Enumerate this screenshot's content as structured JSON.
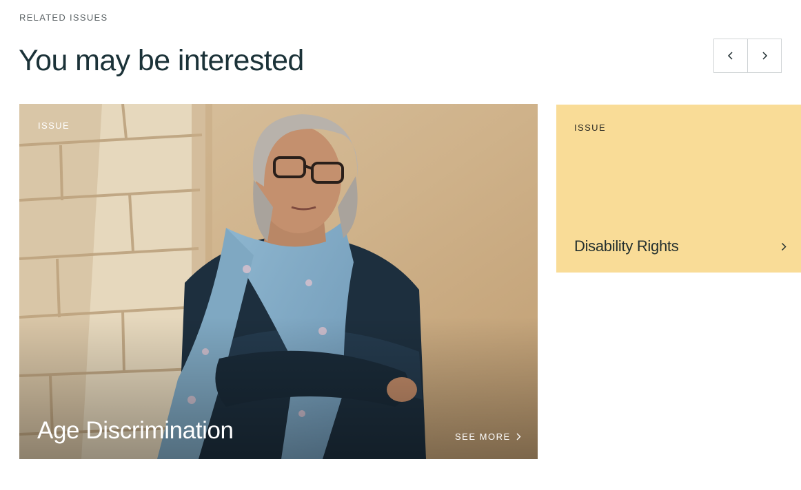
{
  "section": {
    "eyebrow": "RELATED ISSUES",
    "heading": "You may be interested"
  },
  "pager": {
    "prev_icon": "chevron-left-icon",
    "next_icon": "chevron-right-icon"
  },
  "cards": [
    {
      "tag": "ISSUE",
      "title": "Age Discrimination",
      "cta": "SEE MORE",
      "cta_icon": "chevron-right-icon",
      "image": "portrait-photo"
    },
    {
      "tag": "ISSUE",
      "title": "Disability Rights",
      "cta_icon": "chevron-right-icon",
      "background": "#f9dc97"
    }
  ],
  "colors": {
    "heading": "#1b3238",
    "yellow_card": "#f9dc97",
    "border": "#cfd3d5"
  }
}
